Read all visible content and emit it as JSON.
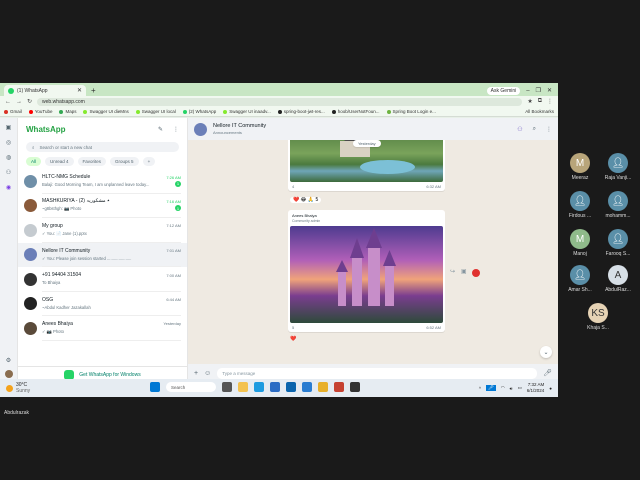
{
  "browser": {
    "tab_title": "(1) WhatsApp",
    "new_tab": "+",
    "ask_gemini": "Ask Gemini",
    "url": "web.whatsapp.com",
    "bookmarks": [
      "Gmail",
      "YouTube",
      "Maps",
      "Swagger UI dieMns",
      "Swagger UI local",
      "(2) WhatsApp",
      "Swagger UI inaadv...",
      "spring-boot-jwt-res...",
      "hoob/UserNotFoun...",
      "Spring Boot Login e..."
    ],
    "all_bookmarks": "All Bookmarks"
  },
  "whatsapp": {
    "title": "WhatsApp",
    "search_placeholder": "Search or start a new chat",
    "filters": [
      "All",
      "Unread 4",
      "Favorites",
      "Groups 5",
      "+"
    ],
    "chats": [
      {
        "name": "HLTC-NMG Schedule",
        "preview": "Balaji: Good Morning Team, I am unplanned leave today...",
        "time": "7:26 AM",
        "badge": "1",
        "unread": true
      },
      {
        "name": "MASHKURIYA - (2) ٭ مشکوریہ",
        "preview": "~g8bsthgh: 📷 Photo",
        "time": "7:16 AM",
        "badge": "1",
        "unread": true
      },
      {
        "name": "My group",
        "preview": "✓ You: 📄 Jane (1).pptx",
        "time": "7:12 AM",
        "badge": "",
        "unread": false
      },
      {
        "name": "Nellore IT Community",
        "preview": "✓ You: Please join session started .....................",
        "time": "7:01 AM",
        "badge": "",
        "unread": false
      },
      {
        "name": "+91 94404 31504",
        "preview": "To Bhaiya",
        "time": "7:00 AM",
        "badge": "",
        "unread": false
      },
      {
        "name": "OSG",
        "preview": "~Abdul Kadher Jazakallah",
        "time": "6:44 AM",
        "badge": "",
        "unread": false
      },
      {
        "name": "Anees Bhaiya",
        "preview": "✓ 📷 Photo",
        "time": "Yesterday",
        "badge": "",
        "unread": false
      }
    ],
    "get_app": "Get WhatsApp for Windows",
    "conversation": {
      "name": "Nellore IT Community",
      "subtitle": "Announcements",
      "date_pill": "Yesterday",
      "msg1_reactions": "❤️ 😂 🙏 5",
      "msg1_time": "6:32 AM",
      "msg1_count": "4",
      "msg2_sender": "Anees Bhaiya",
      "msg2_role": "Community admin",
      "msg2_count": "5",
      "msg2_time": "6:52 AM",
      "msg2_reaction": "❤️",
      "composer_placeholder": "Type a message"
    }
  },
  "taskbar": {
    "temp": "30°C",
    "weather": "Sunny",
    "search": "Search",
    "time": "7:32 AM",
    "date": "6/1/2024"
  },
  "participants": [
    {
      "initial": "M",
      "name": "Meeraz",
      "color": "#b8a57a"
    },
    {
      "initial": "",
      "name": "Raja Vanji...",
      "color": "#5a8fa8"
    },
    {
      "initial": "",
      "name": "Firdous ...",
      "color": "#5a8fa8"
    },
    {
      "initial": "",
      "name": "mohamm...",
      "color": "#5a8fa8"
    },
    {
      "initial": "M",
      "name": "Manoj",
      "color": "#8fba8a"
    },
    {
      "initial": "",
      "name": "Farooq S...",
      "color": "#5a8fa8"
    },
    {
      "initial": "",
      "name": "Amar Sh...",
      "color": "#5a8fa8"
    },
    {
      "initial": "A",
      "name": "AbdulRaz...",
      "color": "#d7dfe6"
    },
    {
      "initial": "KS",
      "name": "Khaja S...",
      "color": "#e6d3b5"
    }
  ],
  "self_name": "Abdulrazak"
}
